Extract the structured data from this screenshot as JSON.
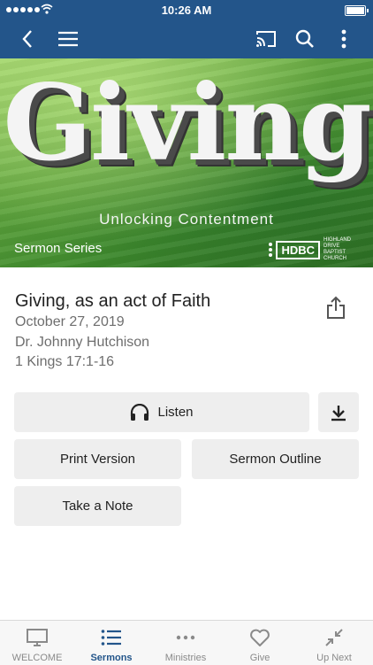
{
  "status_bar": {
    "time": "10:26 AM"
  },
  "nav": {
    "icons": [
      "back-icon",
      "menu-icon",
      "cast-icon",
      "search-icon",
      "more-icon"
    ],
    "color": "#23558a"
  },
  "hero": {
    "title": "Giving",
    "subtitle": "Unlocking Contentment",
    "series_label": "Sermon Series",
    "logo_text": "HDBC",
    "logo_small": "HIGHLAND DRIVE BAPTIST CHURCH"
  },
  "sermon": {
    "title": "Giving, as an act of Faith",
    "date": "October 27, 2019",
    "speaker": "Dr. Johnny Hutchison",
    "passage": "1 Kings 17:1-16"
  },
  "actions": {
    "listen": "Listen",
    "print": "Print Version",
    "outline": "Sermon Outline",
    "note": "Take a Note"
  },
  "tabs": [
    {
      "label": "WELCOME",
      "icon": "monitor-icon",
      "active": false
    },
    {
      "label": "Sermons",
      "icon": "list-icon",
      "active": true
    },
    {
      "label": "Ministries",
      "icon": "dots-icon",
      "active": false
    },
    {
      "label": "Give",
      "icon": "heart-icon",
      "active": false
    },
    {
      "label": "Up Next",
      "icon": "collapse-icon",
      "active": false
    }
  ]
}
